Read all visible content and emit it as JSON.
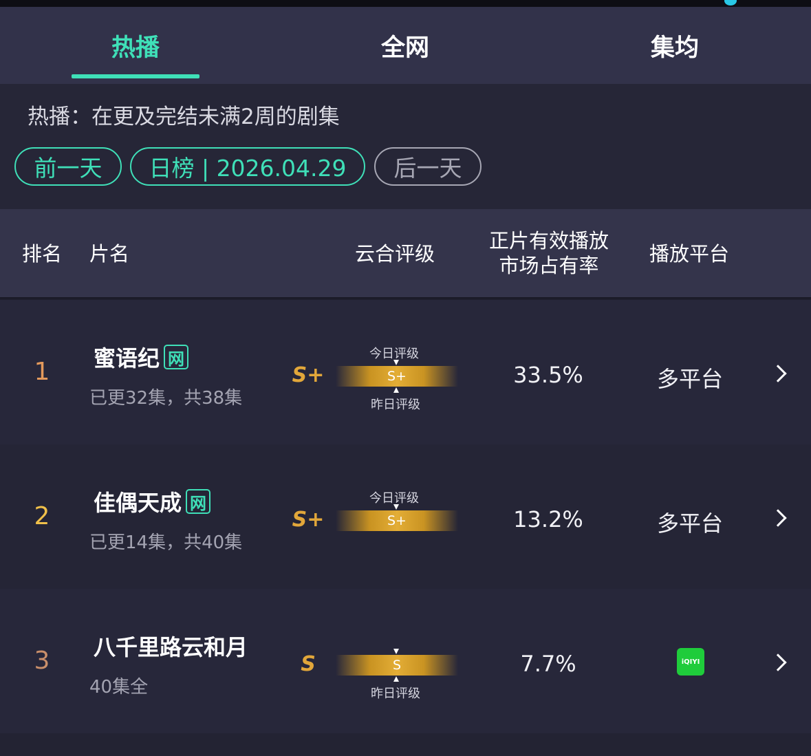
{
  "tabs": [
    {
      "label": "热播",
      "active": true
    },
    {
      "label": "全网",
      "active": false
    },
    {
      "label": "集均",
      "active": false
    }
  ],
  "info": {
    "description": "热播：在更及完结未满2周的剧集",
    "prev_day": "前一天",
    "date_label": "日榜 | 2026.04.29",
    "next_day": "后一天"
  },
  "columns": {
    "rank": "排名",
    "title": "片名",
    "grade": "云合评级",
    "share_line1": "正片有效播放",
    "share_line2": "市场占有率",
    "platform": "播放平台"
  },
  "rows": [
    {
      "rank": "1",
      "title": "蜜语纪",
      "badge": "网",
      "episodes": "已更32集，共38集",
      "grade": "S+",
      "bar_grade": "S+",
      "today_label": "今日评级",
      "yesterday_label": "昨日评级",
      "share": "33.5%",
      "platform": "多平台"
    },
    {
      "rank": "2",
      "title": "佳偶天成",
      "badge": "网",
      "episodes": "已更14集，共40集",
      "grade": "S+",
      "bar_grade": "S+",
      "today_label": "今日评级",
      "share": "13.2%",
      "platform": "多平台"
    },
    {
      "rank": "3",
      "title": "八千里路云和月",
      "episodes": "40集全",
      "grade": "S",
      "bar_grade": "S",
      "yesterday_label": "昨日评级",
      "share": "7.7%",
      "platform_logo": "iQIYI"
    }
  ],
  "colors": {
    "accent": "#3fe0b8",
    "grade_gold": "#e2a73a",
    "rank_1": "#e49a5c",
    "rank_2": "#f0c04a",
    "rank_3": "#c98f6a",
    "iqiyi_green": "#1fcc3b"
  }
}
